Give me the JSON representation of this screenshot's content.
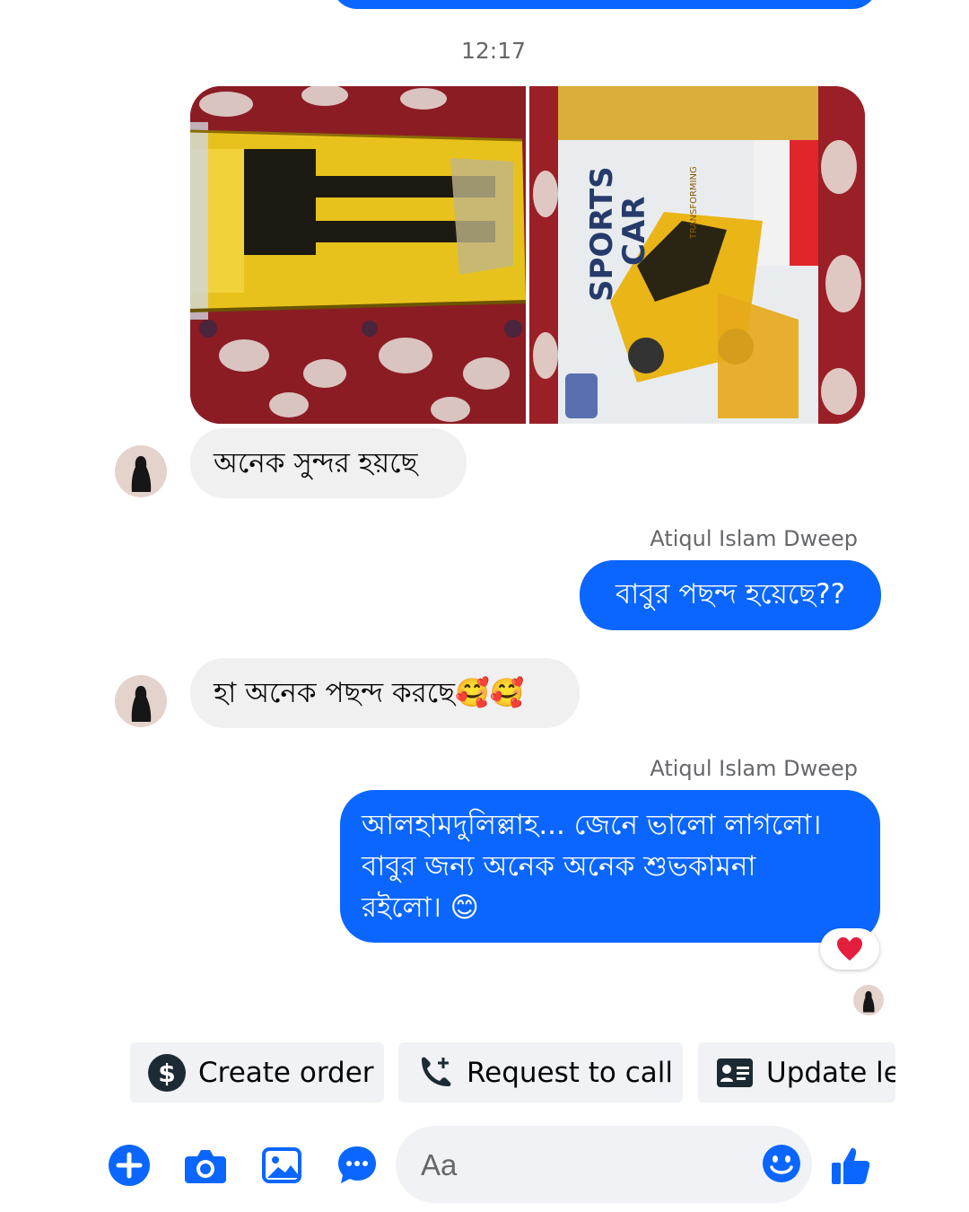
{
  "thread": {
    "timestamp": "12:17",
    "messages": [
      {
        "from": "contact",
        "text": "অনেক সুন্দর হয়ছে"
      },
      {
        "from": "me",
        "sender_label": "Atiqul Islam Dweep",
        "text": "বাবুর পছন্দ হয়েছে??"
      },
      {
        "from": "contact",
        "text": "হা অনেক পছন্দ করছে🥰🥰"
      },
      {
        "from": "me",
        "sender_label": "Atiqul Islam Dweep",
        "lines": [
          "আলহামদুলিল্লাহ... জেনে ভালো লাগলো।",
          "বাবুর জন্য অনেক অনেক শুভকামনা",
          "রইলো। 😊"
        ],
        "reaction": "❤️"
      }
    ],
    "photos": {
      "left_box_text": "",
      "right_box_line1": "SPORTS",
      "right_box_line2": "CAR",
      "right_box_badge": "TRANSFORMING"
    }
  },
  "quick_actions": [
    {
      "label": "Create order",
      "icon": "dollar-circle-icon"
    },
    {
      "label": "Request to call",
      "icon": "phone-plus-icon"
    },
    {
      "label": "Update le",
      "icon": "id-card-icon"
    }
  ],
  "composer": {
    "placeholder": "Aa",
    "icons": [
      "plus-circle-icon",
      "camera-icon",
      "gallery-icon",
      "chat-bubble-icon",
      "emoji-icon",
      "thumbs-up-icon"
    ]
  },
  "colors": {
    "accent": "#0a66ff",
    "incoming_bubble": "#f0f0f0",
    "chip_bg": "#f0f2f5"
  }
}
